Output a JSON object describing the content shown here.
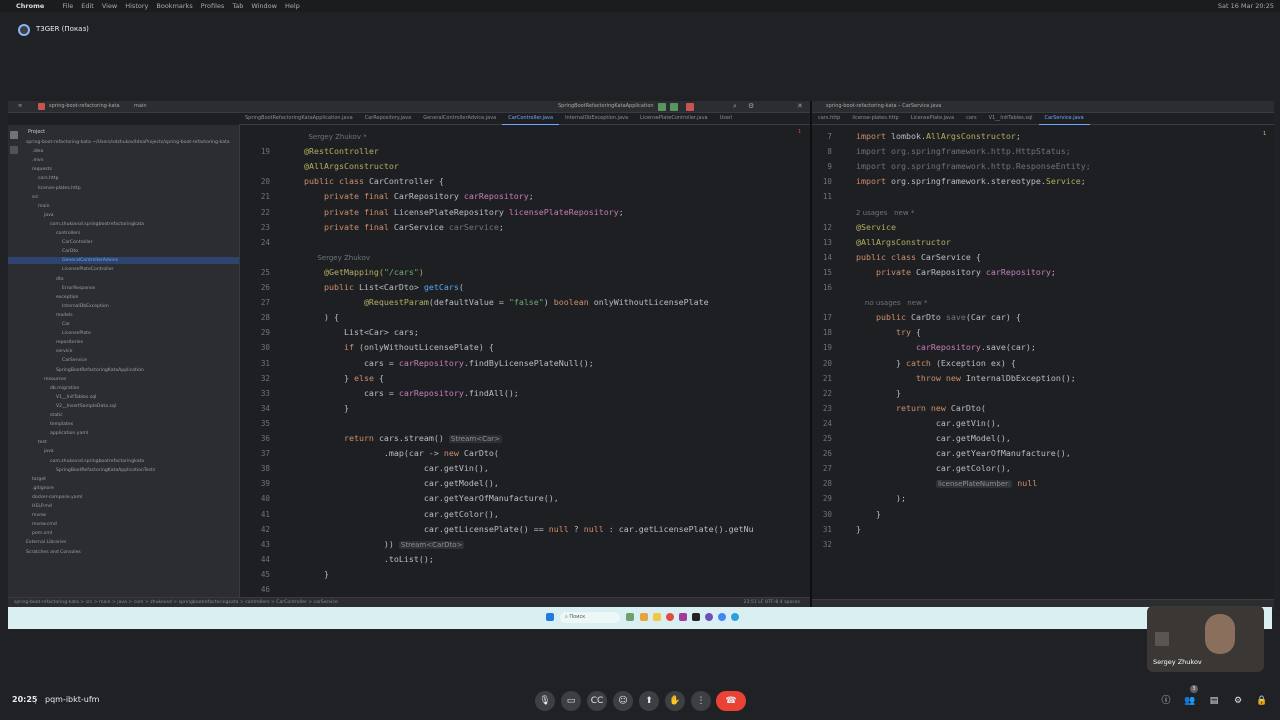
{
  "mac_menu": {
    "app": "Chrome",
    "items": [
      "File",
      "Edit",
      "View",
      "History",
      "Bookmarks",
      "Profiles",
      "Tab",
      "Window",
      "Help"
    ],
    "clock": "Sat 16 Mar 20:25"
  },
  "meet": {
    "presenter": "T3GER (Показ)",
    "time": "20:25",
    "meeting_code": "pqm-ibkt-ufm",
    "participant_name": "Sergey Zhukov",
    "participant_count": "3"
  },
  "ide_left": {
    "project": "spring-boot-refactoring-kata",
    "branch": "main",
    "run_config": "SpringBootRefactoringKataApplication",
    "tool_label": "Project",
    "tabs": [
      "SpringBootRefactoringKataApplication.java",
      "CarRepository.java",
      "GeneralControllerAdvice.java",
      "CarController.java",
      "InternalDbException.java",
      "LicensePlateController.java",
      "Userl"
    ],
    "active_tab": "CarController.java",
    "error_count": "1",
    "tree": [
      {
        "label": "spring-boot-refactoring-kata ~/Users/sdzhukov/IdeaProjects/spring-boot-refactoring-kata",
        "indent": 0
      },
      {
        "label": ".idea",
        "indent": 1
      },
      {
        "label": ".mvn",
        "indent": 1
      },
      {
        "label": "requests",
        "indent": 1
      },
      {
        "label": "cars.http",
        "indent": 2
      },
      {
        "label": "license-plates.http",
        "indent": 2
      },
      {
        "label": "src",
        "indent": 1
      },
      {
        "label": "main",
        "indent": 2
      },
      {
        "label": "java",
        "indent": 3
      },
      {
        "label": "com.zhukovsd.springbootrefactoringkata",
        "indent": 4
      },
      {
        "label": "controllers",
        "indent": 5
      },
      {
        "label": "CarController",
        "indent": 6
      },
      {
        "label": "CarDto",
        "indent": 6
      },
      {
        "label": "GeneralControllerAdvice",
        "indent": 6,
        "sel": true
      },
      {
        "label": "LicensePlateController",
        "indent": 6
      },
      {
        "label": "dto",
        "indent": 5
      },
      {
        "label": "ErrorResponse",
        "indent": 6
      },
      {
        "label": "exception",
        "indent": 5
      },
      {
        "label": "InternalDbException",
        "indent": 6
      },
      {
        "label": "models",
        "indent": 5
      },
      {
        "label": "Car",
        "indent": 6
      },
      {
        "label": "LicensePlate",
        "indent": 6
      },
      {
        "label": "repositories",
        "indent": 5
      },
      {
        "label": "service",
        "indent": 5
      },
      {
        "label": "CarService",
        "indent": 6
      },
      {
        "label": "SpringBootRefactoringKataApplication",
        "indent": 5
      },
      {
        "label": "resources",
        "indent": 3
      },
      {
        "label": "db.migration",
        "indent": 4
      },
      {
        "label": "V1__InitTables.sql",
        "indent": 5
      },
      {
        "label": "V2__InsertSampleData.sql",
        "indent": 5
      },
      {
        "label": "static",
        "indent": 4
      },
      {
        "label": "templates",
        "indent": 4
      },
      {
        "label": "application.yaml",
        "indent": 4
      },
      {
        "label": "test",
        "indent": 2
      },
      {
        "label": "java",
        "indent": 3
      },
      {
        "label": "com.zhukovsd.springbootrefactoringkata",
        "indent": 4
      },
      {
        "label": "SpringBootRefactoringKataApplicationTests",
        "indent": 5
      },
      {
        "label": "target",
        "indent": 1
      },
      {
        "label": ".gitignore",
        "indent": 1
      },
      {
        "label": "docker-compose.yaml",
        "indent": 1
      },
      {
        "label": "HELP.md",
        "indent": 1
      },
      {
        "label": "mvnw",
        "indent": 1
      },
      {
        "label": "mvnw.cmd",
        "indent": 1
      },
      {
        "label": "pom.xml",
        "indent": 1
      },
      {
        "label": "External Libraries",
        "indent": 0
      },
      {
        "label": "Scratches and Consoles",
        "indent": 0
      }
    ],
    "breadcrumb": "spring-boot-refactoring-kata > src > main > java > com > zhukovsd > springbootrefactoringkata > controllers > CarController > carService",
    "status_right": "23:51   LF   UTF-8   4 spaces"
  },
  "ide_right": {
    "project": "spring-boot-refactoring-kata – CarService.java",
    "tabs": [
      "cars.http",
      "license-plates.http",
      "LicensePlate.java",
      "cars",
      "V1__InitTables.sql",
      "CarService.java"
    ],
    "active_tab": "CarService.java",
    "warn_count": "1"
  },
  "left_code": [
    {
      "n": "",
      "h": [
        {
          "c": "hint",
          "t": "  Sergey Zhukov *"
        }
      ]
    },
    {
      "n": "19",
      "h": [
        {
          "c": "an",
          "t": "@RestController"
        }
      ]
    },
    {
      "n": "",
      "h": [
        {
          "c": "an",
          "t": "@AllArgsConstructor"
        }
      ]
    },
    {
      "n": "20",
      "h": [
        {
          "c": "kw",
          "t": "public class "
        },
        {
          "c": "ty",
          "t": "CarController {"
        }
      ]
    },
    {
      "n": "21",
      "h": [
        {
          "c": "kw",
          "t": "    private final "
        },
        {
          "c": "ty",
          "t": "CarRepository "
        },
        {
          "c": "fld",
          "t": "carRepository"
        },
        {
          "c": "ty",
          "t": ";"
        }
      ]
    },
    {
      "n": "22",
      "h": [
        {
          "c": "kw",
          "t": "    private final "
        },
        {
          "c": "ty",
          "t": "LicensePlateRepository "
        },
        {
          "c": "fld",
          "t": "licensePlateRepository"
        },
        {
          "c": "ty",
          "t": ";"
        }
      ]
    },
    {
      "n": "23",
      "h": [
        {
          "c": "kw",
          "t": "    private final "
        },
        {
          "c": "ty",
          "t": "CarService "
        },
        {
          "c": "dim",
          "t": "carService"
        },
        {
          "c": "ty",
          "t": ";"
        }
      ]
    },
    {
      "n": "24",
      "h": []
    },
    {
      "n": "",
      "h": [
        {
          "c": "hint",
          "t": "      Sergey Zhukov"
        }
      ]
    },
    {
      "n": "25",
      "h": [
        {
          "c": "an",
          "t": "    @GetMapping("
        },
        {
          "c": "str",
          "t": "\"/cars\""
        },
        {
          "c": "an",
          "t": ")"
        }
      ]
    },
    {
      "n": "26",
      "h": [
        {
          "c": "kw",
          "t": "    public "
        },
        {
          "c": "ty",
          "t": "List<CarDto> "
        },
        {
          "c": "fn",
          "t": "getCars"
        },
        {
          "c": "ty",
          "t": "("
        }
      ]
    },
    {
      "n": "27",
      "h": [
        {
          "c": "an",
          "t": "            @RequestParam"
        },
        {
          "c": "ty",
          "t": "(defaultValue = "
        },
        {
          "c": "str",
          "t": "\"false\""
        },
        {
          "c": "ty",
          "t": ") "
        },
        {
          "c": "kw",
          "t": "boolean "
        },
        {
          "c": "ty",
          "t": "onlyWithoutLicensePlate"
        }
      ]
    },
    {
      "n": "28",
      "h": [
        {
          "c": "ty",
          "t": "    ) {"
        }
      ]
    },
    {
      "n": "29",
      "h": [
        {
          "c": "ty",
          "t": "        List<Car> cars;"
        }
      ]
    },
    {
      "n": "30",
      "h": [
        {
          "c": "kw",
          "t": "        if "
        },
        {
          "c": "ty",
          "t": "(onlyWithoutLicensePlate) {"
        }
      ]
    },
    {
      "n": "31",
      "h": [
        {
          "c": "ty",
          "t": "            cars = "
        },
        {
          "c": "fld",
          "t": "carRepository"
        },
        {
          "c": "ty",
          "t": ".findByLicensePlateNull();"
        }
      ]
    },
    {
      "n": "32",
      "h": [
        {
          "c": "ty",
          "t": "        } "
        },
        {
          "c": "kw",
          "t": "else "
        },
        {
          "c": "ty",
          "t": "{"
        }
      ]
    },
    {
      "n": "33",
      "h": [
        {
          "c": "ty",
          "t": "            cars = "
        },
        {
          "c": "fld",
          "t": "carRepository"
        },
        {
          "c": "ty",
          "t": ".findAll();"
        }
      ]
    },
    {
      "n": "34",
      "h": [
        {
          "c": "ty",
          "t": "        }"
        }
      ]
    },
    {
      "n": "35",
      "h": []
    },
    {
      "n": "36",
      "h": [
        {
          "c": "kw",
          "t": "        return "
        },
        {
          "c": "ty",
          "t": "cars.stream() "
        },
        {
          "c": "inlay",
          "t": "Stream<Car>"
        }
      ]
    },
    {
      "n": "37",
      "h": [
        {
          "c": "ty",
          "t": "                .map(car -> "
        },
        {
          "c": "kw",
          "t": "new "
        },
        {
          "c": "ty",
          "t": "CarDto("
        }
      ]
    },
    {
      "n": "38",
      "h": [
        {
          "c": "ty",
          "t": "                        car.getVin(),"
        }
      ]
    },
    {
      "n": "39",
      "h": [
        {
          "c": "ty",
          "t": "                        car.getModel(),"
        }
      ]
    },
    {
      "n": "40",
      "h": [
        {
          "c": "ty",
          "t": "                        car.getYearOfManufacture(),"
        }
      ]
    },
    {
      "n": "41",
      "h": [
        {
          "c": "ty",
          "t": "                        car.getColor(),"
        }
      ]
    },
    {
      "n": "42",
      "h": [
        {
          "c": "ty",
          "t": "                        car.getLicensePlate() == "
        },
        {
          "c": "kw",
          "t": "null "
        },
        {
          "c": "ty",
          "t": "? "
        },
        {
          "c": "kw",
          "t": "null "
        },
        {
          "c": "ty",
          "t": ": car.getLicensePlate().getNu"
        }
      ]
    },
    {
      "n": "43",
      "h": [
        {
          "c": "ty",
          "t": "                )) "
        },
        {
          "c": "inlay",
          "t": "Stream<CarDto>"
        }
      ]
    },
    {
      "n": "44",
      "h": [
        {
          "c": "ty",
          "t": "                .toList();"
        }
      ]
    },
    {
      "n": "45",
      "h": [
        {
          "c": "ty",
          "t": "    }"
        }
      ]
    },
    {
      "n": "46",
      "h": []
    }
  ],
  "right_code": [
    {
      "n": "7",
      "h": [
        {
          "c": "kw",
          "t": "import "
        },
        {
          "c": "ty",
          "t": "lombok."
        },
        {
          "c": "an",
          "t": "AllArgsConstructor"
        },
        {
          "c": "ty",
          "t": ";"
        }
      ]
    },
    {
      "n": "8",
      "h": [
        {
          "c": "dim",
          "t": "import org.springframework.http.HttpStatus;"
        }
      ]
    },
    {
      "n": "9",
      "h": [
        {
          "c": "dim",
          "t": "import org.springframework.http.ResponseEntity;"
        }
      ]
    },
    {
      "n": "10",
      "h": [
        {
          "c": "kw",
          "t": "import "
        },
        {
          "c": "ty",
          "t": "org.springframework.stereotype."
        },
        {
          "c": "an",
          "t": "Service"
        },
        {
          "c": "ty",
          "t": ";"
        }
      ]
    },
    {
      "n": "11",
      "h": []
    },
    {
      "n": "",
      "h": [
        {
          "c": "hint",
          "t": "2 usages   new *"
        }
      ]
    },
    {
      "n": "12",
      "h": [
        {
          "c": "an",
          "t": "@Service"
        }
      ]
    },
    {
      "n": "13",
      "h": [
        {
          "c": "an",
          "t": "@AllArgsConstructor"
        }
      ]
    },
    {
      "n": "14",
      "h": [
        {
          "c": "kw",
          "t": "public class "
        },
        {
          "c": "ty",
          "t": "CarService {"
        }
      ]
    },
    {
      "n": "15",
      "h": [
        {
          "c": "kw",
          "t": "    private "
        },
        {
          "c": "ty",
          "t": "CarRepository "
        },
        {
          "c": "fld",
          "t": "carRepository"
        },
        {
          "c": "ty",
          "t": ";"
        }
      ]
    },
    {
      "n": "16",
      "h": []
    },
    {
      "n": "",
      "h": [
        {
          "c": "hint",
          "t": "    no usages   new *"
        }
      ]
    },
    {
      "n": "17",
      "h": [
        {
          "c": "kw",
          "t": "    public "
        },
        {
          "c": "ty",
          "t": "CarDto "
        },
        {
          "c": "dim",
          "t": "save"
        },
        {
          "c": "ty",
          "t": "(Car car) {"
        }
      ]
    },
    {
      "n": "18",
      "h": [
        {
          "c": "kw",
          "t": "        try "
        },
        {
          "c": "ty",
          "t": "{"
        }
      ]
    },
    {
      "n": "19",
      "h": [
        {
          "c": "fld",
          "t": "            carRepository"
        },
        {
          "c": "ty",
          "t": ".save(car);"
        }
      ]
    },
    {
      "n": "20",
      "h": [
        {
          "c": "ty",
          "t": "        } "
        },
        {
          "c": "kw",
          "t": "catch "
        },
        {
          "c": "ty",
          "t": "(Exception ex) {"
        }
      ]
    },
    {
      "n": "21",
      "h": [
        {
          "c": "kw",
          "t": "            throw new "
        },
        {
          "c": "ty",
          "t": "InternalDbException();"
        }
      ]
    },
    {
      "n": "22",
      "h": [
        {
          "c": "ty",
          "t": "        }"
        }
      ]
    },
    {
      "n": "23",
      "h": [
        {
          "c": "kw",
          "t": "        return new "
        },
        {
          "c": "ty",
          "t": "CarDto("
        }
      ]
    },
    {
      "n": "24",
      "h": [
        {
          "c": "ty",
          "t": "                car.getVin(),"
        }
      ]
    },
    {
      "n": "25",
      "h": [
        {
          "c": "ty",
          "t": "                car.getModel(),"
        }
      ]
    },
    {
      "n": "26",
      "h": [
        {
          "c": "ty",
          "t": "                car.getYearOfManufacture(),"
        }
      ]
    },
    {
      "n": "27",
      "h": [
        {
          "c": "ty",
          "t": "                car.getColor(),"
        }
      ]
    },
    {
      "n": "28",
      "h": [
        {
          "c": "ty",
          "t": "                "
        },
        {
          "c": "inlay",
          "t": "licensePlateNumber:"
        },
        {
          "c": "kw",
          "t": " null"
        }
      ]
    },
    {
      "n": "29",
      "h": [
        {
          "c": "ty",
          "t": "        );"
        }
      ]
    },
    {
      "n": "30",
      "h": [
        {
          "c": "ty",
          "t": "    }"
        }
      ]
    },
    {
      "n": "31",
      "h": [
        {
          "c": "ty",
          "t": "}"
        }
      ]
    },
    {
      "n": "32",
      "h": []
    }
  ],
  "taskbar": {
    "search_placeholder": "Поиск"
  },
  "icons": [
    "google-meet-icon",
    "mic-icon",
    "camera-icon",
    "captions-icon",
    "emoji-icon",
    "present-icon",
    "raise-hand-icon",
    "more-icon",
    "end-call-icon",
    "info-icon",
    "people-icon",
    "chat-icon",
    "activities-icon",
    "lock-icon"
  ],
  "colors": {
    "end_call": "#ea4335",
    "accent": "#8ab4f8",
    "ide_bg": "#1e1f22"
  }
}
